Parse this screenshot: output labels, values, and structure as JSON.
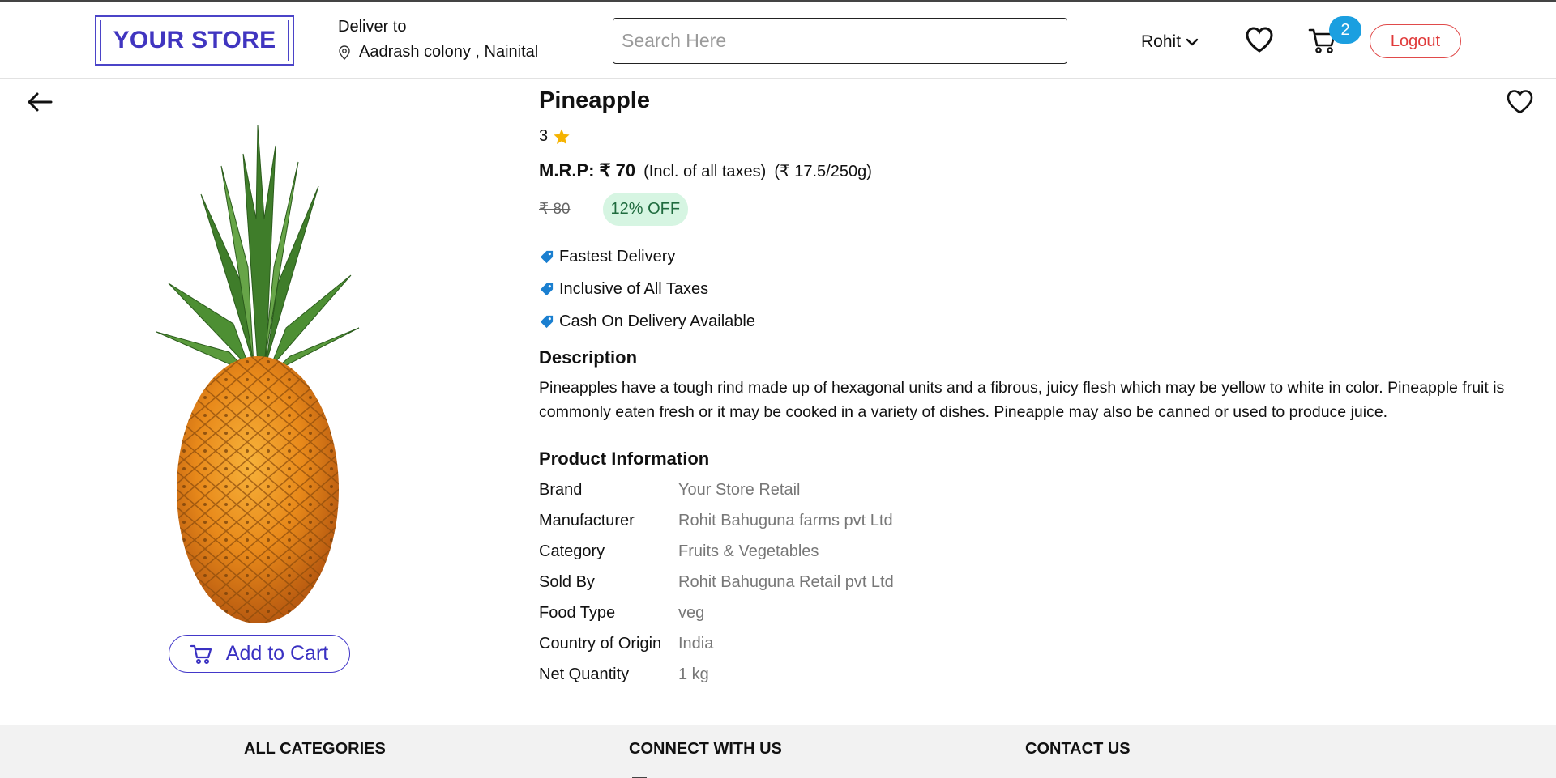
{
  "header": {
    "logo": "YOUR STORE",
    "deliver_label": "Deliver to",
    "address": "Aadrash colony , Nainital",
    "search_placeholder": "Search Here",
    "user_name": "Rohit",
    "cart_count": "2",
    "logout_label": "Logout"
  },
  "product": {
    "name": "Pineapple",
    "rating": "3",
    "mrp_label": "M.R.P: ₹ 70",
    "tax_note": "(Incl. of all taxes)",
    "unit_price": "(₹ 17.5/250g)",
    "old_price": "₹ 80",
    "discount": "12% OFF",
    "features": [
      "Fastest Delivery",
      "Inclusive of All Taxes",
      "Cash On Delivery Available"
    ],
    "description_title": "Description",
    "description": "Pineapples have a tough rind made up of hexagonal units and a fibrous, juicy flesh which may be yellow to white in color. Pineapple fruit is commonly eaten fresh or it may be cooked in a variety of dishes. Pineapple may also be canned or used to produce juice.",
    "info_title": "Product Information",
    "info": [
      {
        "key": "Brand",
        "value": "Your Store Retail"
      },
      {
        "key": "Manufacturer",
        "value": "Rohit Bahuguna farms pvt Ltd"
      },
      {
        "key": "Category",
        "value": "Fruits & Vegetables"
      },
      {
        "key": "Sold By",
        "value": "Rohit Bahuguna Retail pvt Ltd"
      },
      {
        "key": "Food Type",
        "value": "veg"
      },
      {
        "key": "Country of Origin",
        "value": "India"
      },
      {
        "key": "Net Quantity",
        "value": "1 kg"
      }
    ],
    "add_to_cart_label": "Add to Cart"
  },
  "footer": {
    "categories": "ALL CATEGORIES",
    "connect": "CONNECT WITH US",
    "contact": "CONTACT US"
  },
  "colors": {
    "brand": "#4035c0",
    "badge": "#1b9fe0",
    "logout": "#e03a3a",
    "discount_bg": "#d6f5e2",
    "feature_tag": "#1a7fd0",
    "star": "#f5b301"
  },
  "icons": {
    "location": "location-pin-icon",
    "chevron": "chevron-down-icon",
    "wishlist": "heart-icon",
    "cart": "cart-icon",
    "back": "arrow-left-icon",
    "star": "star-icon",
    "tag": "tag-icon"
  }
}
